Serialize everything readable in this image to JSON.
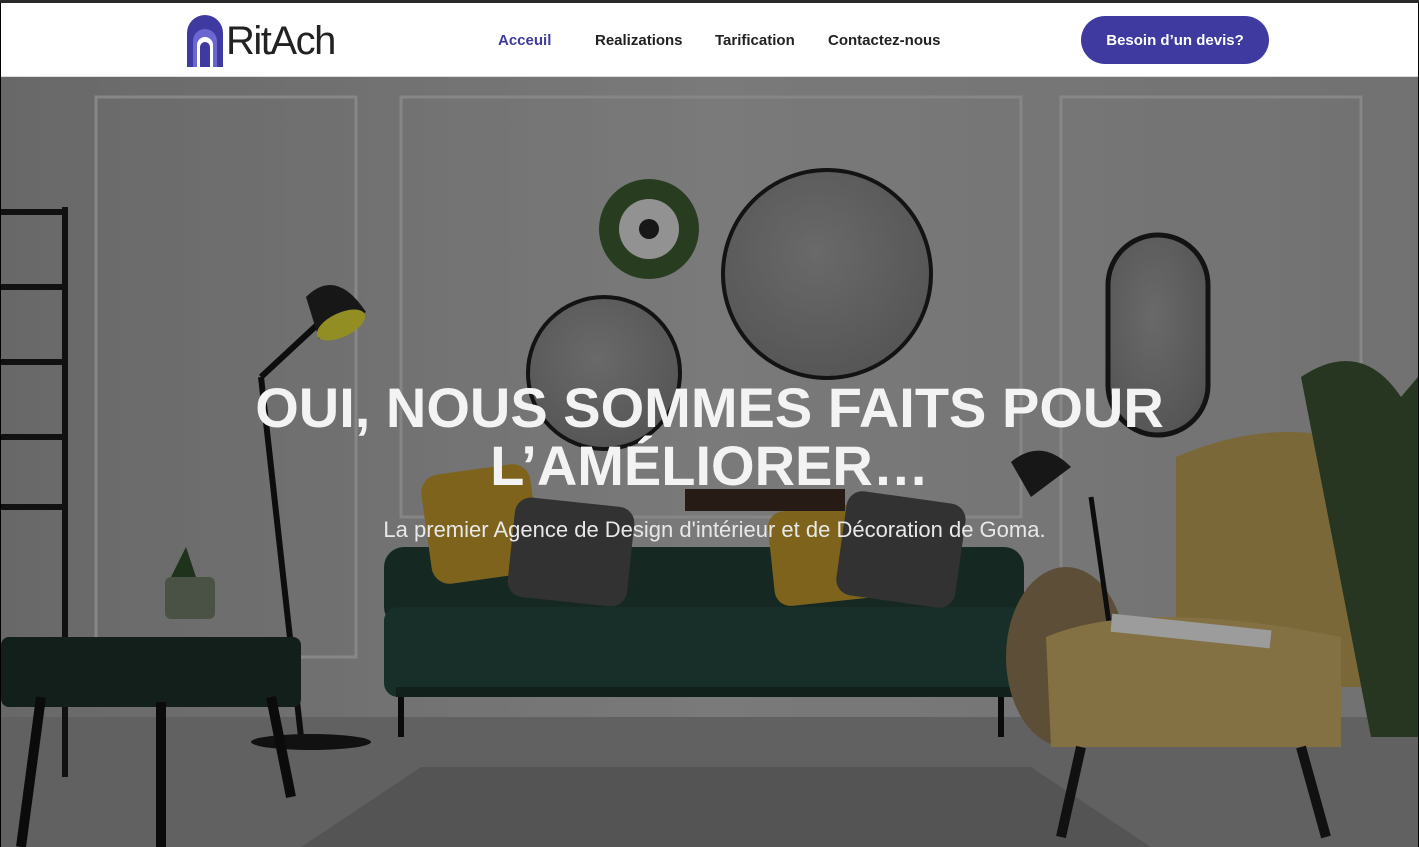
{
  "brand": {
    "name": "RitAch",
    "accent": "#3f3aa0"
  },
  "nav": {
    "items": [
      {
        "label": "Acceuil",
        "active": true
      },
      {
        "label": "Realizations",
        "active": false
      },
      {
        "label": "Tarification",
        "active": false
      },
      {
        "label": "Contactez-nous",
        "active": false
      }
    ]
  },
  "cta": {
    "label": "Besoin d’un devis?"
  },
  "hero": {
    "title_line1": "OUI, NOUS SOMMES FAITS POUR",
    "title_line2": "L’AMÉLIORER…",
    "subtitle": "La premier Agence de Design d'intérieur et de Décoration de Goma."
  }
}
